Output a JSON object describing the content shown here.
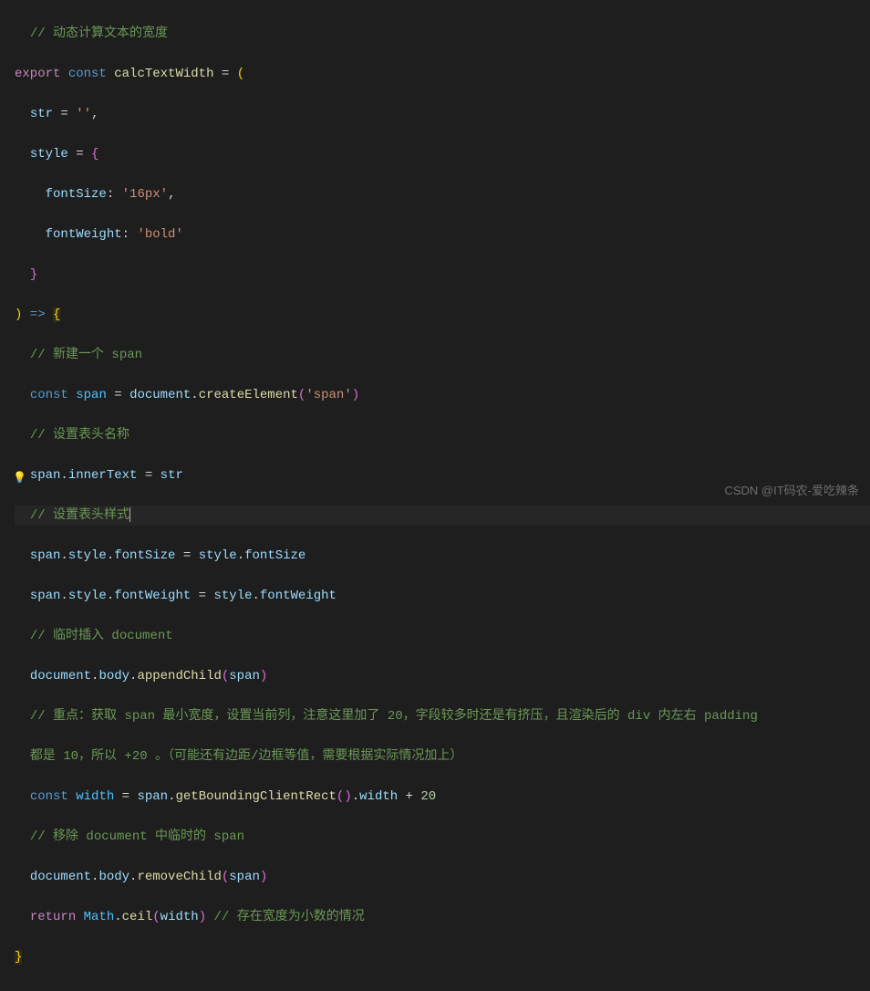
{
  "code": {
    "l1_comment": "// 动态计算文本的宽度",
    "l2_export": "export",
    "l2_const": "const",
    "l2_fname": "calcTextWidth",
    "l2_eq": " = ",
    "l2_paren": "(",
    "l3_param": "str",
    "l3_rest": " = ",
    "l3_str": "''",
    "l3_comma": ",",
    "l4_param": "style",
    "l4_eq": " = ",
    "l4_brace": "{",
    "l5_prop": "fontSize",
    "l5_colon": ": ",
    "l5_val": "'16px'",
    "l5_comma": ",",
    "l6_prop": "fontWeight",
    "l6_colon": ": ",
    "l6_val": "'bold'",
    "l7_brace": "}",
    "l8_paren": ")",
    "l8_arrow": " => ",
    "l8_brace": "{",
    "l9_comment": "// 新建一个 span",
    "l10_const": "const",
    "l10_var": "span",
    "l10_eq": " = ",
    "l10_obj": "document",
    "l10_dot": ".",
    "l10_method": "createElement",
    "l10_p1": "(",
    "l10_str": "'span'",
    "l10_p2": ")",
    "l11_comment": "// 设置表头名称",
    "l12_obj": "span",
    "l12_dot": ".",
    "l12_prop": "innerText",
    "l12_eq": " = ",
    "l12_var": "str",
    "l13_comment": "// 设置表头样式",
    "l14_obj": "span",
    "l14_d1": ".",
    "l14_p1": "style",
    "l14_d2": ".",
    "l14_p2": "fontSize",
    "l14_eq": " = ",
    "l14_obj2": "style",
    "l14_d3": ".",
    "l14_p3": "fontSize",
    "l15_obj": "span",
    "l15_d1": ".",
    "l15_p1": "style",
    "l15_d2": ".",
    "l15_p2": "fontWeight",
    "l15_eq": " = ",
    "l15_obj2": "style",
    "l15_d3": ".",
    "l15_p3": "fontWeight",
    "l16_comment": "// 临时插入 document",
    "l17_obj": "document",
    "l17_d1": ".",
    "l17_p1": "body",
    "l17_d2": ".",
    "l17_method": "appendChild",
    "l17_p2": "(",
    "l17_arg": "span",
    "l17_p3": ")",
    "l18_comment": "// 重点：获取 span 最小宽度，设置当前列，注意这里加了 20，字段较多时还是有挤压，且渲染后的 div 内左右 padding ",
    "l18b_comment": "都是 10，所以 +20 。（可能还有边距/边框等值，需要根据实际情况加上）",
    "l19_const": "const",
    "l19_var": "width",
    "l19_eq": " = ",
    "l19_obj": "span",
    "l19_d1": ".",
    "l19_method": "getBoundingClientRect",
    "l19_p1": "(",
    "l19_p2": ")",
    "l19_d2": ".",
    "l19_prop": "width",
    "l19_plus": " + ",
    "l19_num": "20",
    "l20_comment": "// 移除 document 中临时的 span",
    "l21_obj": "document",
    "l21_d1": ".",
    "l21_p1": "body",
    "l21_d2": ".",
    "l21_method": "removeChild",
    "l21_p2": "(",
    "l21_arg": "span",
    "l21_p3": ")",
    "l22_ret": "return",
    "l22_obj": "Math",
    "l22_d1": ".",
    "l22_method": "ceil",
    "l22_p1": "(",
    "l22_arg": "width",
    "l22_p2": ")",
    "l22_comment": " // 存在宽度为小数的情况",
    "l23_brace": "}"
  },
  "watermark": "CSDN @IT码农-爱吃辣条"
}
